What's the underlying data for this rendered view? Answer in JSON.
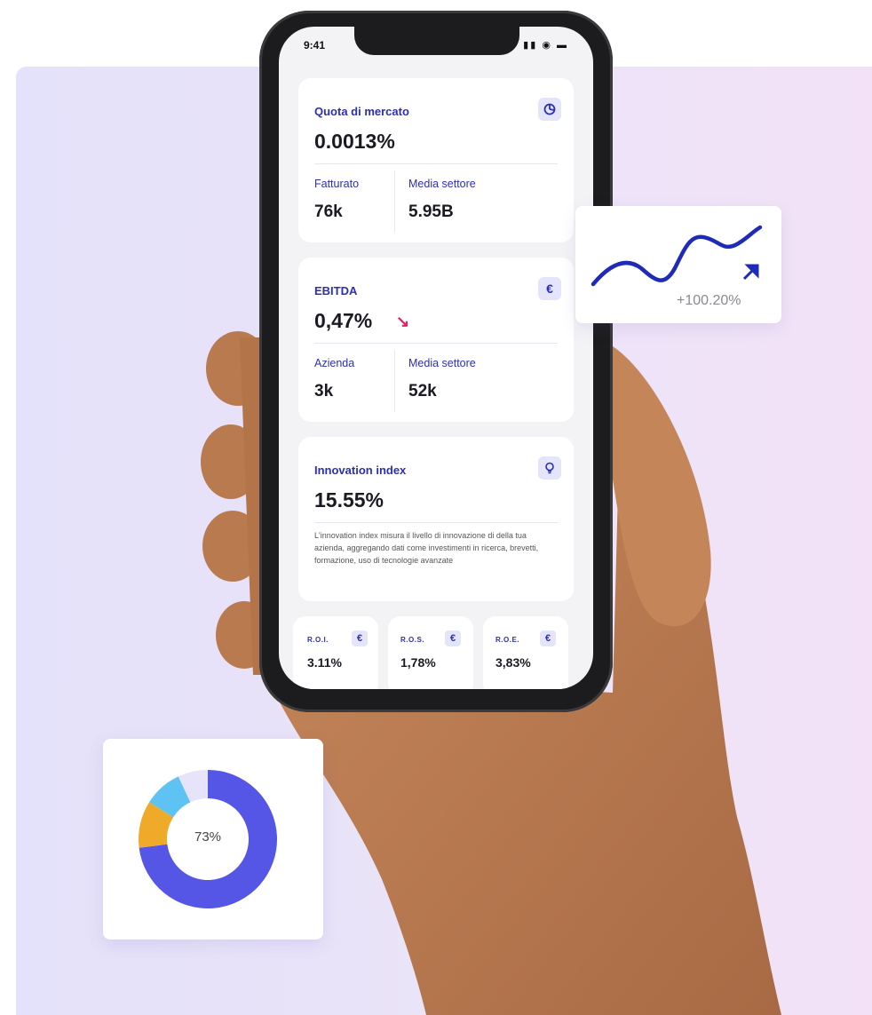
{
  "status_bar": {
    "time": "9:41",
    "icons": "▮▮ ◉ ▬"
  },
  "cards": {
    "market_share": {
      "title": "Quota di mercato",
      "value": "0.0013%",
      "icon": "pie-chart-icon",
      "left_label": "Fatturato",
      "left_value": "76k",
      "right_label": "Media settore",
      "right_value": "5.95B"
    },
    "ebitda": {
      "title": "EBITDA",
      "value": "0,47%",
      "trend_arrow": "↘",
      "icon": "euro-icon",
      "icon_glyph": "€",
      "left_label": "Azienda",
      "left_value": "3k",
      "right_label": "Media settore",
      "right_value": "52k"
    },
    "innovation": {
      "title": "Innovation index",
      "value": "15.55%",
      "icon": "lightbulb-icon",
      "description": "L'innovation index misura il livello di innovazione di della tua azienda, aggregando dati come investimenti in ricerca, brevetti, formazione, uso di tecnologie avanzate"
    },
    "ratios": [
      {
        "label": "R.O.I.",
        "value": "3.11%",
        "icon_glyph": "€"
      },
      {
        "label": "R.O.S.",
        "value": "1,78%",
        "icon_glyph": "€"
      },
      {
        "label": "R.O.E.",
        "value": "3,83%",
        "icon_glyph": "€"
      }
    ]
  },
  "trend_card": {
    "value": "+100.20%",
    "arrow_icon": "arrow-up-right-icon",
    "line_color": "#1f2bb8"
  },
  "donut_card": {
    "center_label": "73%",
    "segments": [
      {
        "value": 73,
        "color": "#5555e6"
      },
      {
        "value": 11,
        "color": "#f0aa2a"
      },
      {
        "value": 9,
        "color": "#5ec2f2"
      },
      {
        "value": 7,
        "color": "#e7e3fb"
      }
    ]
  },
  "colors": {
    "accent": "#2b2fb5",
    "negative": "#e0245e"
  }
}
